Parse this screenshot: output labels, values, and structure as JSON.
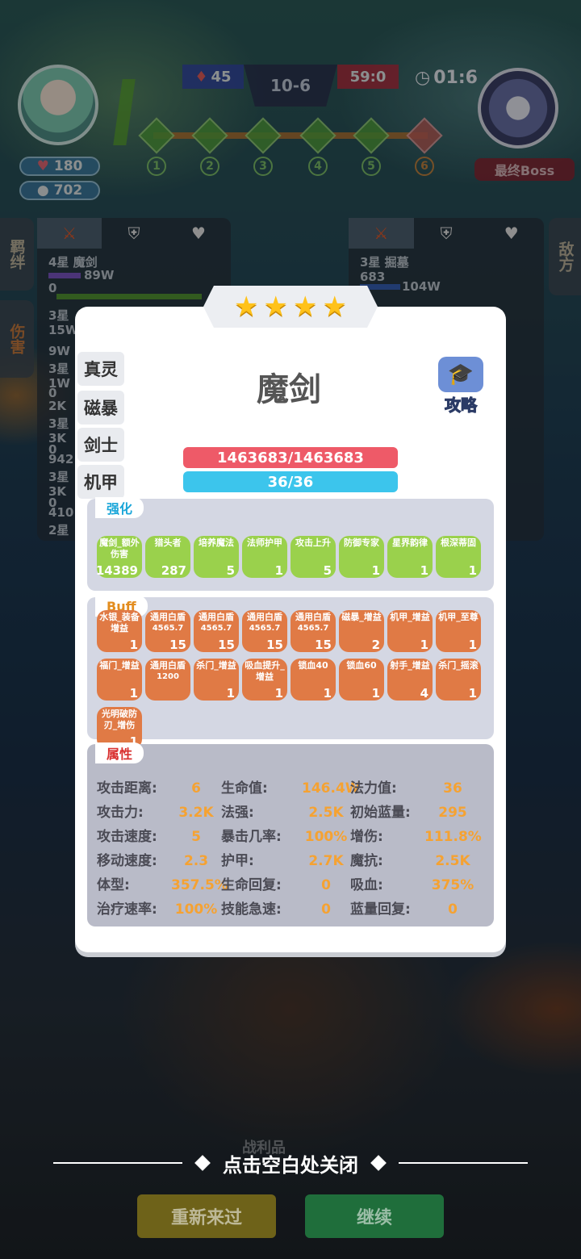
{
  "hud": {
    "player_hp": "180",
    "player_gold": "702",
    "score_left": "45",
    "round": "10-6",
    "score_right": "59:0",
    "timer": "01:6",
    "boss_label": "最终Boss",
    "stages": [
      "1",
      "2",
      "3",
      "4",
      "5",
      "6"
    ]
  },
  "side_tabs": {
    "bond": "羁绊",
    "damage": "伤害",
    "enemy": "敌方"
  },
  "left_panel": {
    "title": "4星 魔剑",
    "value": "89W",
    "value2": "0",
    "rows": [
      "3星",
      "15W",
      "9W",
      "3星",
      "1W",
      "0",
      "2K",
      "3星",
      "3K",
      "0",
      "942",
      "3星",
      "3K",
      "0",
      "410",
      "2星"
    ]
  },
  "right_panel": {
    "title": "3星 掘墓",
    "value": "683",
    "value2": "104W"
  },
  "modal": {
    "stars": 4,
    "categories": [
      "真灵",
      "磁暴",
      "剑士",
      "机甲"
    ],
    "unit_name": "魔剑",
    "guide_label": "攻略",
    "hp": "1463683/1463683",
    "mana": "36/36",
    "enhance_label": "强化",
    "enhance": [
      {
        "name": "魔剑_额外伤害",
        "value": "14389"
      },
      {
        "name": "猎头者",
        "value": "287"
      },
      {
        "name": "培养魔法",
        "value": "5"
      },
      {
        "name": "法师护甲",
        "value": "1"
      },
      {
        "name": "攻击上升",
        "value": "5"
      },
      {
        "name": "防御专家",
        "value": "1"
      },
      {
        "name": "星界韵律",
        "value": "1"
      },
      {
        "name": "根深蒂固",
        "value": "1"
      }
    ],
    "buff_label": "Buff",
    "buffs": [
      {
        "name": "水银_装备增益",
        "sub": "",
        "value": "1"
      },
      {
        "name": "通用白盾",
        "sub": "4565.7",
        "value": "15"
      },
      {
        "name": "通用白盾",
        "sub": "4565.7",
        "value": "15"
      },
      {
        "name": "通用白盾",
        "sub": "4565.7",
        "value": "15"
      },
      {
        "name": "通用白盾",
        "sub": "4565.7",
        "value": "15"
      },
      {
        "name": "磁暴_增益",
        "sub": "",
        "value": "2"
      },
      {
        "name": "机甲_增益",
        "sub": "",
        "value": "1"
      },
      {
        "name": "机甲_至尊",
        "sub": "",
        "value": "1"
      },
      {
        "name": "福门_增益",
        "sub": "",
        "value": "1"
      },
      {
        "name": "通用白盾",
        "sub": "1200",
        "value": ""
      },
      {
        "name": "杀门_增益",
        "sub": "",
        "value": "1"
      },
      {
        "name": "吸血提升_增益",
        "sub": "",
        "value": "1"
      },
      {
        "name": "锁血40",
        "sub": "",
        "value": "1"
      },
      {
        "name": "锁血60",
        "sub": "",
        "value": "1"
      },
      {
        "name": "射手_增益",
        "sub": "",
        "value": "4"
      },
      {
        "name": "杀门_摇滚",
        "sub": "",
        "value": "1"
      },
      {
        "name": "光明破防刃_增伤",
        "sub": "",
        "value": "1"
      }
    ],
    "attr_label": "属性",
    "attributes": [
      {
        "label": "攻击距离:",
        "value": "6"
      },
      {
        "label": "生命值:",
        "value": "146.4W"
      },
      {
        "label": "法力值:",
        "value": "36"
      },
      {
        "label": "攻击力:",
        "value": "3.2K"
      },
      {
        "label": "法强:",
        "value": "2.5K"
      },
      {
        "label": "初始蓝量:",
        "value": "295"
      },
      {
        "label": "攻击速度:",
        "value": "5"
      },
      {
        "label": "暴击几率:",
        "value": "100%"
      },
      {
        "label": "增伤:",
        "value": "111.8%"
      },
      {
        "label": "移动速度:",
        "value": "2.3"
      },
      {
        "label": "护甲:",
        "value": "2.7K"
      },
      {
        "label": "魔抗:",
        "value": "2.5K"
      },
      {
        "label": "体型:",
        "value": "357.5%"
      },
      {
        "label": "生命回复:",
        "value": "0"
      },
      {
        "label": "吸血:",
        "value": "375%"
      },
      {
        "label": "治疗速率:",
        "value": "100%"
      },
      {
        "label": "技能急速:",
        "value": "0"
      },
      {
        "label": "蓝量回复:",
        "value": "0"
      }
    ]
  },
  "footer": {
    "close_hint": "点击空白处关闭",
    "spoils": "战利品",
    "retry": "重新来过",
    "continue": "继续"
  }
}
